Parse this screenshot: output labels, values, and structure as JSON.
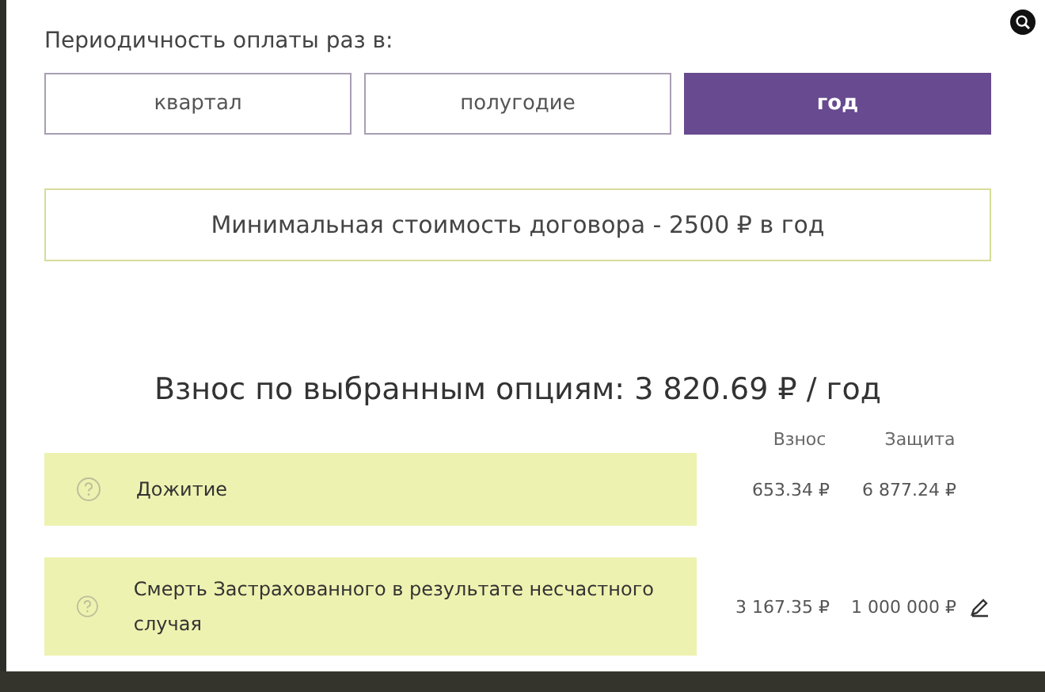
{
  "period": {
    "label": "Периодичность оплаты раз в:",
    "options": [
      {
        "label": "квартал",
        "selected": false
      },
      {
        "label": "полугодие",
        "selected": false
      },
      {
        "label": "год",
        "selected": true
      }
    ]
  },
  "min_notice": "Минимальная стоимость договора - 2500 ₽ в год",
  "total": "Взнос по выбранным опциям: 3 820.69 ₽ / год",
  "table": {
    "columns": [
      "Взнос",
      "Защита"
    ],
    "rows": [
      {
        "name": "Дожитие",
        "fee": "653.34 ₽",
        "cover": "6 877.24 ₽",
        "editable": false
      },
      {
        "name": "Смерть Застрахованного в результате несчастного случая",
        "fee": "3 167.35 ₽",
        "cover": "1 000 000 ₽",
        "editable": true
      }
    ]
  }
}
